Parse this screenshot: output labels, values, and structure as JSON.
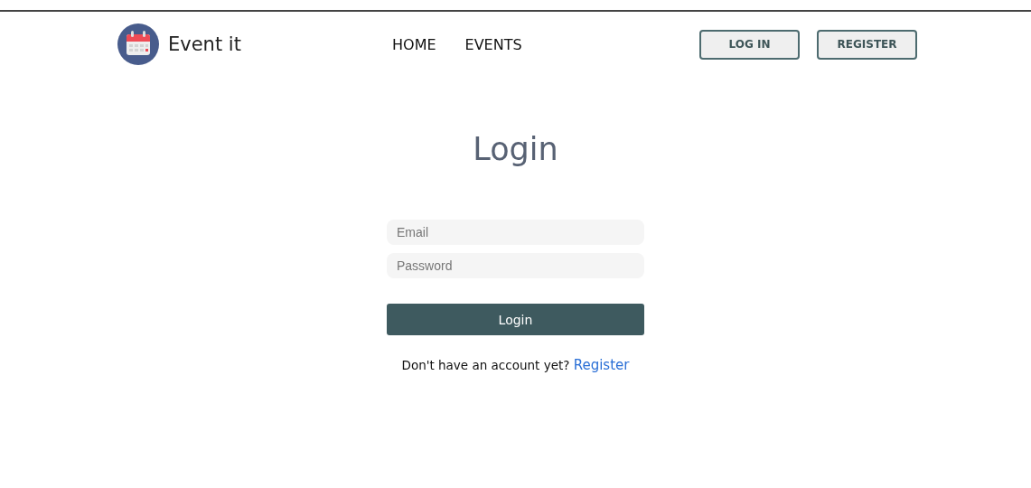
{
  "header": {
    "brand": "Event it",
    "nav": [
      "HOME",
      "EVENTS"
    ],
    "buttons": [
      "LOG IN",
      "REGISTER"
    ]
  },
  "login": {
    "title": "Login",
    "fields": [
      {
        "placeholder": "Email"
      },
      {
        "placeholder": "Password"
      }
    ],
    "submit": "Login",
    "prompt": "Don't have an account yet?",
    "link": "Register"
  }
}
